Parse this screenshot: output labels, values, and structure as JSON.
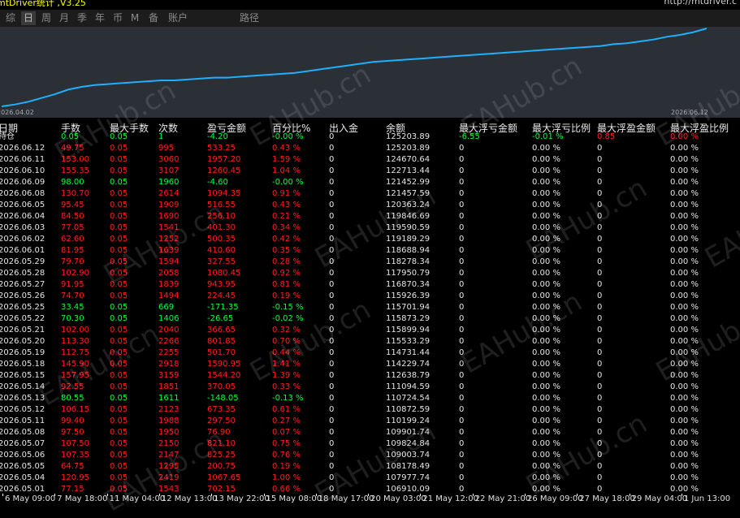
{
  "window": {
    "title_left": "mtDriver统计 ,V3.25",
    "title_right": "http://mtdriver.c"
  },
  "tabs": [
    {
      "label": "综",
      "active": false
    },
    {
      "label": "日",
      "active": true
    },
    {
      "label": "周",
      "active": false
    },
    {
      "label": "月",
      "active": false
    },
    {
      "label": "季",
      "active": false
    },
    {
      "label": "年",
      "active": false
    },
    {
      "label": "币",
      "active": false
    },
    {
      "label": "M",
      "active": false
    },
    {
      "label": "备",
      "active": false
    },
    {
      "label": "账户",
      "active": false
    },
    {
      "label": "路径",
      "active": false
    }
  ],
  "equity_chart": {
    "start_label": "2026.04.02",
    "end_label": "2026.06.12",
    "line_color": "#1eb0ff",
    "values": [
      0,
      2,
      5,
      9,
      13,
      18,
      21,
      23,
      24,
      25,
      26,
      27,
      28,
      28,
      29,
      30,
      31,
      31,
      32,
      33,
      34,
      35,
      36,
      38,
      40,
      42,
      44,
      46,
      48,
      49,
      50,
      51,
      52,
      53,
      54,
      55,
      56,
      57,
      58,
      59,
      60,
      61,
      62,
      63,
      64,
      65,
      67,
      68,
      70,
      72,
      75,
      77,
      80,
      84
    ]
  },
  "table": {
    "headers": [
      "日期",
      "手数",
      "最大手数",
      "次数",
      "盈亏金额",
      "百分比%",
      "出入金",
      "余额",
      "最大浮亏金额",
      "最大浮亏比例",
      "最大浮盈金额",
      "最大浮盈比例"
    ],
    "holding_row": {
      "label": "持仓",
      "lots": "0.05",
      "max_lots": "0.05",
      "count": "1",
      "pl": "-4.20",
      "pct": "-0.00 %",
      "io": "0",
      "balance": "125203.89",
      "max_float_loss": "-6.55",
      "max_float_loss_pct": "-0.01 %",
      "max_float_profit": "0.85",
      "max_float_profit_pct": "0.00 %"
    },
    "rows": [
      {
        "date": "2026.06.12",
        "lots": "49.75",
        "max_lots": "0.05",
        "count": "995",
        "pl": "533.25",
        "pct": "0.43 %",
        "balance": "125203.89"
      },
      {
        "date": "2026.06.11",
        "lots": "153.00",
        "max_lots": "0.05",
        "count": "3060",
        "pl": "1957.20",
        "pct": "1.59 %",
        "balance": "124670.64"
      },
      {
        "date": "2026.06.10",
        "lots": "155.35",
        "max_lots": "0.05",
        "count": "3107",
        "pl": "1260.45",
        "pct": "1.04 %",
        "balance": "122713.44"
      },
      {
        "date": "2026.06.09",
        "lots": "98.00",
        "max_lots": "0.05",
        "count": "1960",
        "pl": "-4.60",
        "pct": "-0.00 %",
        "balance": "121452.99"
      },
      {
        "date": "2026.06.08",
        "lots": "130.70",
        "max_lots": "0.05",
        "count": "2614",
        "pl": "1094.35",
        "pct": "0.91 %",
        "balance": "121457.59"
      },
      {
        "date": "2026.06.05",
        "lots": "95.45",
        "max_lots": "0.05",
        "count": "1909",
        "pl": "516.55",
        "pct": "0.43 %",
        "balance": "120363.24"
      },
      {
        "date": "2026.06.04",
        "lots": "84.50",
        "max_lots": "0.05",
        "count": "1690",
        "pl": "256.10",
        "pct": "0.21 %",
        "balance": "119846.69"
      },
      {
        "date": "2026.06.03",
        "lots": "77.05",
        "max_lots": "0.05",
        "count": "1541",
        "pl": "401.30",
        "pct": "0.34 %",
        "balance": "119590.59"
      },
      {
        "date": "2026.06.02",
        "lots": "62.60",
        "max_lots": "0.05",
        "count": "1252",
        "pl": "500.35",
        "pct": "0.42 %",
        "balance": "119189.29"
      },
      {
        "date": "2026.06.01",
        "lots": "81.95",
        "max_lots": "0.05",
        "count": "1639",
        "pl": "410.60",
        "pct": "0.35 %",
        "balance": "118688.94"
      },
      {
        "date": "2026.05.29",
        "lots": "79.70",
        "max_lots": "0.05",
        "count": "1594",
        "pl": "327.55",
        "pct": "0.28 %",
        "balance": "118278.34"
      },
      {
        "date": "2026.05.28",
        "lots": "102.90",
        "max_lots": "0.05",
        "count": "2058",
        "pl": "1080.45",
        "pct": "0.92 %",
        "balance": "117950.79"
      },
      {
        "date": "2026.05.27",
        "lots": "91.95",
        "max_lots": "0.05",
        "count": "1839",
        "pl": "943.95",
        "pct": "0.81 %",
        "balance": "116870.34"
      },
      {
        "date": "2026.05.26",
        "lots": "74.70",
        "max_lots": "0.05",
        "count": "1494",
        "pl": "224.45",
        "pct": "0.19 %",
        "balance": "115926.39"
      },
      {
        "date": "2026.05.25",
        "lots": "33.45",
        "max_lots": "0.05",
        "count": "669",
        "pl": "-171.35",
        "pct": "-0.15 %",
        "balance": "115701.94"
      },
      {
        "date": "2026.05.22",
        "lots": "70.30",
        "max_lots": "0.05",
        "count": "1406",
        "pl": "-26.65",
        "pct": "-0.02 %",
        "balance": "115873.29"
      },
      {
        "date": "2026.05.21",
        "lots": "102.00",
        "max_lots": "0.05",
        "count": "2040",
        "pl": "366.65",
        "pct": "0.32 %",
        "balance": "115899.94"
      },
      {
        "date": "2026.05.20",
        "lots": "113.30",
        "max_lots": "0.05",
        "count": "2266",
        "pl": "801.85",
        "pct": "0.70 %",
        "balance": "115533.29"
      },
      {
        "date": "2026.05.19",
        "lots": "112.75",
        "max_lots": "0.05",
        "count": "2255",
        "pl": "501.70",
        "pct": "0.44 %",
        "balance": "114731.44"
      },
      {
        "date": "2026.05.18",
        "lots": "145.90",
        "max_lots": "0.05",
        "count": "2918",
        "pl": "1590.95",
        "pct": "1.41 %",
        "balance": "114229.74"
      },
      {
        "date": "2026.05.15",
        "lots": "157.95",
        "max_lots": "0.05",
        "count": "3159",
        "pl": "1544.20",
        "pct": "1.39 %",
        "balance": "112638.79"
      },
      {
        "date": "2026.05.14",
        "lots": "92.55",
        "max_lots": "0.05",
        "count": "1851",
        "pl": "370.05",
        "pct": "0.33 %",
        "balance": "111094.59"
      },
      {
        "date": "2026.05.13",
        "lots": "80.55",
        "max_lots": "0.05",
        "count": "1611",
        "pl": "-148.05",
        "pct": "-0.13 %",
        "balance": "110724.54"
      },
      {
        "date": "2026.05.12",
        "lots": "106.15",
        "max_lots": "0.05",
        "count": "2123",
        "pl": "673.35",
        "pct": "0.61 %",
        "balance": "110872.59"
      },
      {
        "date": "2026.05.11",
        "lots": "99.40",
        "max_lots": "0.05",
        "count": "1988",
        "pl": "297.50",
        "pct": "0.27 %",
        "balance": "110199.24"
      },
      {
        "date": "2026.05.08",
        "lots": "97.50",
        "max_lots": "0.05",
        "count": "1950",
        "pl": "76.90",
        "pct": "0.07 %",
        "balance": "109901.74"
      },
      {
        "date": "2026.05.07",
        "lots": "107.50",
        "max_lots": "0.05",
        "count": "2150",
        "pl": "821.10",
        "pct": "0.75 %",
        "balance": "109824.84"
      },
      {
        "date": "2026.05.06",
        "lots": "107.35",
        "max_lots": "0.05",
        "count": "2147",
        "pl": "825.25",
        "pct": "0.76 %",
        "balance": "109003.74"
      },
      {
        "date": "2026.05.05",
        "lots": "64.75",
        "max_lots": "0.05",
        "count": "1295",
        "pl": "200.75",
        "pct": "0.19 %",
        "balance": "108178.49"
      },
      {
        "date": "2026.05.04",
        "lots": "120.95",
        "max_lots": "0.05",
        "count": "2419",
        "pl": "1067.65",
        "pct": "1.00 %",
        "balance": "107977.74"
      },
      {
        "date": "2026.05.01",
        "lots": "77.15",
        "max_lots": "0.05",
        "count": "1543",
        "pl": "702.15",
        "pct": "0.66 %",
        "balance": "106910.09"
      }
    ]
  },
  "time_axis": [
    "6 May 09:00",
    "7 May 18:00",
    "11 May 04:00",
    "12 May 13:00",
    "13 May 22:00",
    "15 May 08:00",
    "18 May 17:00",
    "20 May 03:00",
    "21 May 12:00",
    "22 May 21:00",
    "26 May 09:00",
    "27 May 18:00",
    "29 May 04:00",
    "1 Jun 13:00"
  ],
  "watermark": "EAHub.cn"
}
